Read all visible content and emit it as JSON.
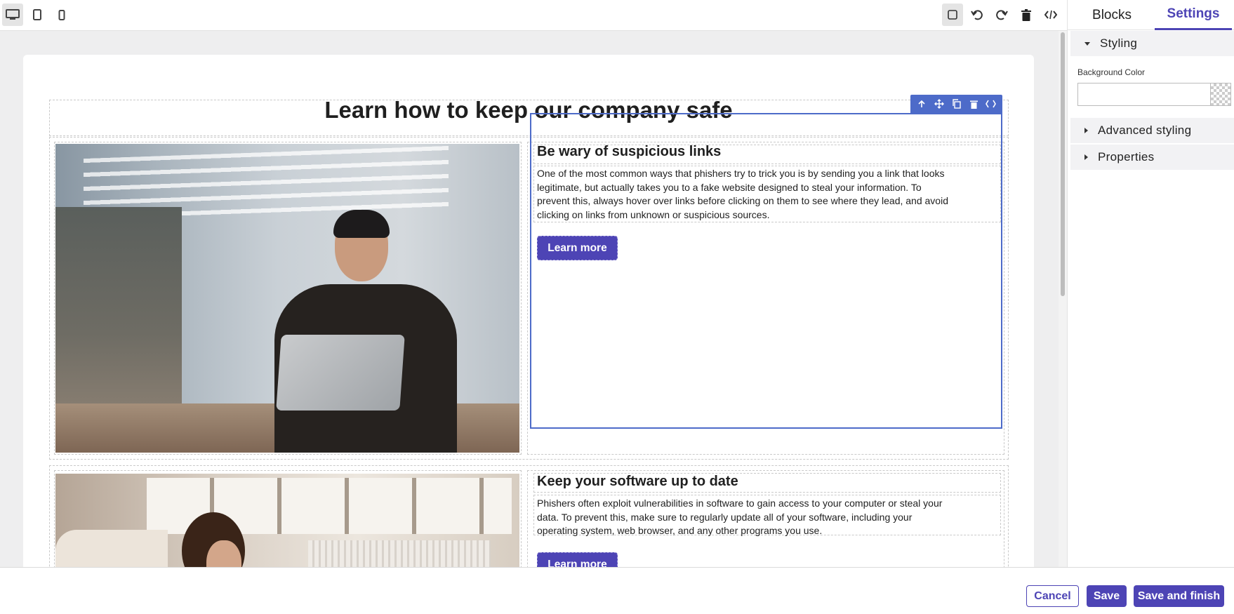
{
  "toolbar": {
    "devices": [
      "desktop-icon",
      "tablet-icon",
      "mobile-icon"
    ],
    "active_device": "desktop",
    "tools": [
      "component-outline-icon",
      "undo-icon",
      "redo-icon",
      "trash-icon",
      "code-icon"
    ]
  },
  "panel": {
    "tabs": [
      {
        "label": "Blocks"
      },
      {
        "label": "Settings"
      }
    ],
    "active_tab": "Settings",
    "sections": {
      "styling": {
        "label": "Styling",
        "expanded": true
      },
      "advanced": {
        "label": "Advanced styling",
        "expanded": false
      },
      "properties": {
        "label": "Properties",
        "expanded": false
      }
    },
    "background_color_label": "Background Color",
    "background_color_value": ""
  },
  "page": {
    "title": "Learn how to keep our company safe",
    "cards": [
      {
        "heading": "Be wary of suspicious links",
        "body": "One of the most common ways that phishers try to trick you is by sending you a link that looks legitimate, but actually takes you to a fake website designed to steal your information. To prevent this, always hover over links before clicking on them to see where they lead, and avoid clicking on links from unknown or suspicious sources.",
        "button": "Learn more"
      },
      {
        "heading": "Keep your software up to date",
        "body": "Phishers often exploit vulnerabilities in software to gain access to your computer or steal your data. To prevent this, make sure to regularly update all of your software, including your operating system, web browser, and any other programs you use.",
        "button": "Learn more"
      }
    ]
  },
  "mini_toolbar": [
    "arrow-up-icon",
    "move-icon",
    "copy-icon",
    "trash-icon",
    "code-icon"
  ],
  "footer": {
    "cancel": "Cancel",
    "save": "Save",
    "save_finish": "Save and finish"
  },
  "colors": {
    "accent": "#4d44b5",
    "selection": "#4d6bc9"
  }
}
